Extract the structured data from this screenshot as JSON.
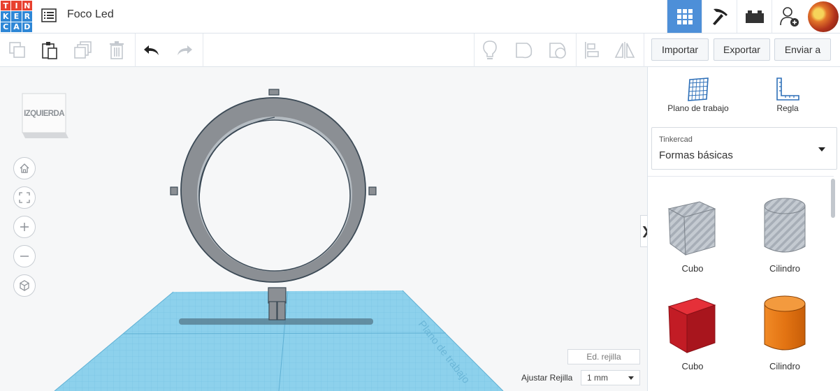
{
  "app": {
    "logo_letters": [
      "T",
      "I",
      "N",
      "K",
      "E",
      "R",
      "C",
      "A",
      "D"
    ],
    "logo_colors": [
      "#e8412f",
      "#e8412f",
      "#e8412f",
      "#2e87d6",
      "#2e87d6",
      "#2e87d6",
      "#2e87d6",
      "#2e87d6",
      "#2e87d6"
    ],
    "doc_title": "Foco Led"
  },
  "toolbar": {
    "import_label": "Importar",
    "export_label": "Exportar",
    "send_label": "Enviar a"
  },
  "viewport": {
    "viewcube_label": "IZQUIERDA",
    "grid_edit_label": "Ed. rejilla",
    "snap_label": "Ajustar Rejilla",
    "snap_value": "1 mm",
    "workplane_watermark": "Plano de trabajo"
  },
  "panel": {
    "workplane_label": "Plano de trabajo",
    "ruler_label": "Regla",
    "library_caption": "Tinkercad",
    "library_value": "Formas básicas",
    "shapes": [
      {
        "name": "Cubo",
        "color": "#b9c0c8"
      },
      {
        "name": "Cilindro",
        "color": "#b9c0c8"
      },
      {
        "name": "Cubo",
        "color": "#d0202a"
      },
      {
        "name": "Cilindro",
        "color": "#ee7d1a"
      }
    ]
  },
  "colors": {
    "accent": "#4d8fd8",
    "workplane": "#8dd1ec",
    "ring": "#8b8f94"
  }
}
